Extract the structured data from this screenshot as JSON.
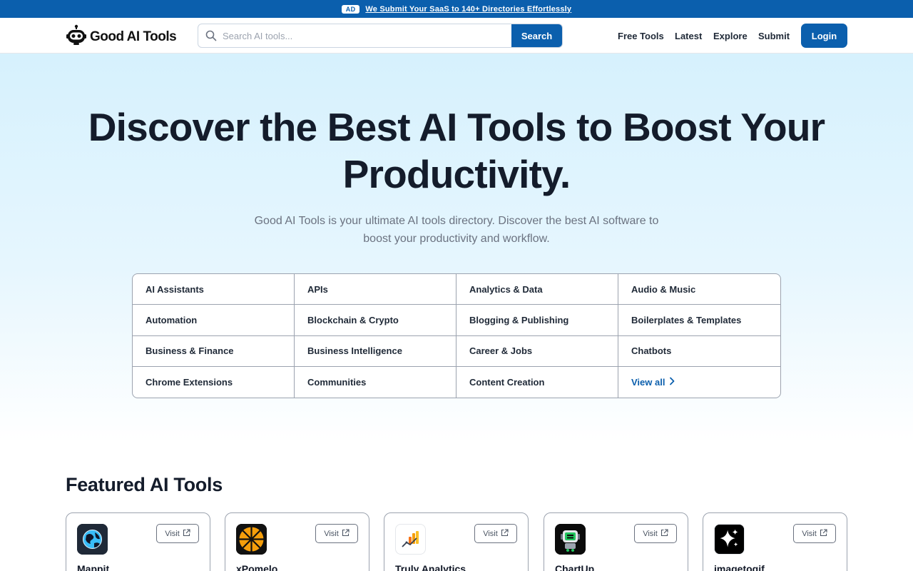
{
  "ad_bar": {
    "badge": "AD",
    "text": "We Submit Your SaaS to 140+ Directories Effortlessly"
  },
  "header": {
    "brand": "Good AI Tools",
    "search": {
      "placeholder": "Search AI tools...",
      "value": "",
      "button": "Search"
    },
    "nav": [
      "Free Tools",
      "Latest",
      "Explore",
      "Submit"
    ],
    "login": "Login"
  },
  "hero": {
    "title_line1": "Discover the Best AI Tools to Boost Your",
    "title_line2": "Productivity.",
    "subtitle_line1": "Good AI Tools is your ultimate AI tools directory. Discover the best AI software to",
    "subtitle_line2": "boost your productivity and workflow."
  },
  "categories": [
    "AI Assistants",
    "APIs",
    "Analytics & Data",
    "Audio & Music",
    "Automation",
    "Blockchain & Crypto",
    "Blogging & Publishing",
    "Boilerplates & Templates",
    "Business & Finance",
    "Business Intelligence",
    "Career & Jobs",
    "Chatbots",
    "Chrome Extensions",
    "Communities",
    "Content Creation"
  ],
  "view_all": "View all",
  "featured": {
    "title": "Featured AI Tools",
    "visit_label": "Visit",
    "tools": [
      {
        "name": "Mappit",
        "icon": "globe-icon"
      },
      {
        "name": "xPomelo",
        "icon": "pomelo-slice-icon"
      },
      {
        "name": "Truly Analytics",
        "icon": "analytics-chart-icon"
      },
      {
        "name": "ChartUp",
        "icon": "robot-chart-icon"
      },
      {
        "name": "imagetogif",
        "icon": "sparkle-icon"
      }
    ]
  },
  "colors": {
    "brand_blue": "#0b5fad",
    "hero_top": "#d6f1fd",
    "text_dark": "#141c2b"
  }
}
